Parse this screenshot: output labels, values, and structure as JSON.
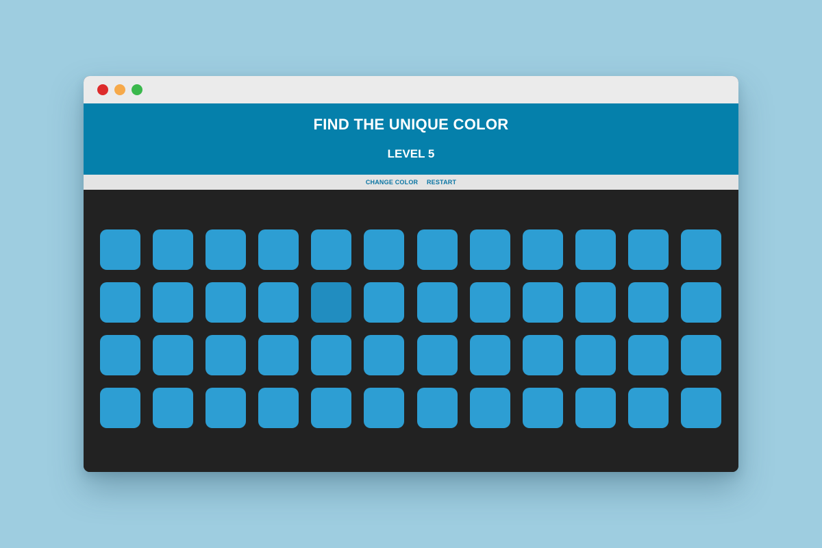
{
  "header": {
    "title": "FIND THE UNIQUE COLOR",
    "level": "LEVEL 5"
  },
  "menu": {
    "change_color": "CHANGE COLOR",
    "restart": "RESTART"
  },
  "colors": {
    "header_bg": "#0580ab",
    "tile": "#2d9ed3",
    "unique_tile": "#218dc0",
    "board_bg": "#222222"
  },
  "grid": {
    "rows": 4,
    "columns": 12,
    "unique_tile": {
      "row": 2,
      "column": 5
    }
  }
}
